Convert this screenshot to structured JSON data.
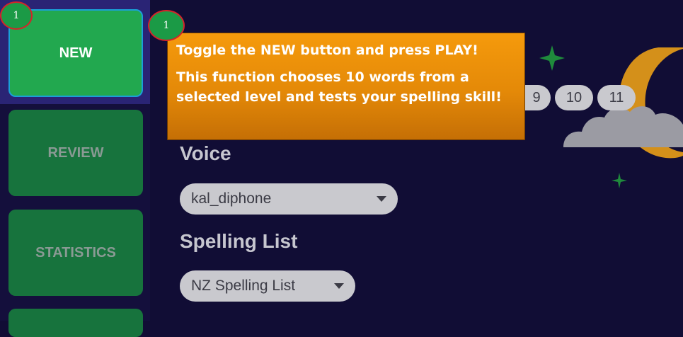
{
  "sidebar": {
    "items": [
      {
        "label": "NEW",
        "active": true
      },
      {
        "label": "REVIEW",
        "active": false
      },
      {
        "label": "STATISTICS",
        "active": false
      }
    ]
  },
  "markers": [
    "1",
    "1"
  ],
  "tooltip": {
    "line1": "Toggle the NEW button and press PLAY!",
    "line2": "This function chooses 10 words from a selected level and tests your spelling skill!"
  },
  "levels": [
    "9",
    "10",
    "11"
  ],
  "voice": {
    "label": "Voice",
    "selected": "kal_diphone"
  },
  "spelling_list": {
    "label": "Spelling List",
    "selected": "NZ Spelling List"
  },
  "colors": {
    "background": "#110d35",
    "active_button": "#22a84f",
    "inactive_button": "#17733d",
    "tooltip": "#f0920a",
    "moon": "#d4901a"
  },
  "decorations": [
    "crescent-moon-icon",
    "cloud-icon",
    "star-icon"
  ]
}
